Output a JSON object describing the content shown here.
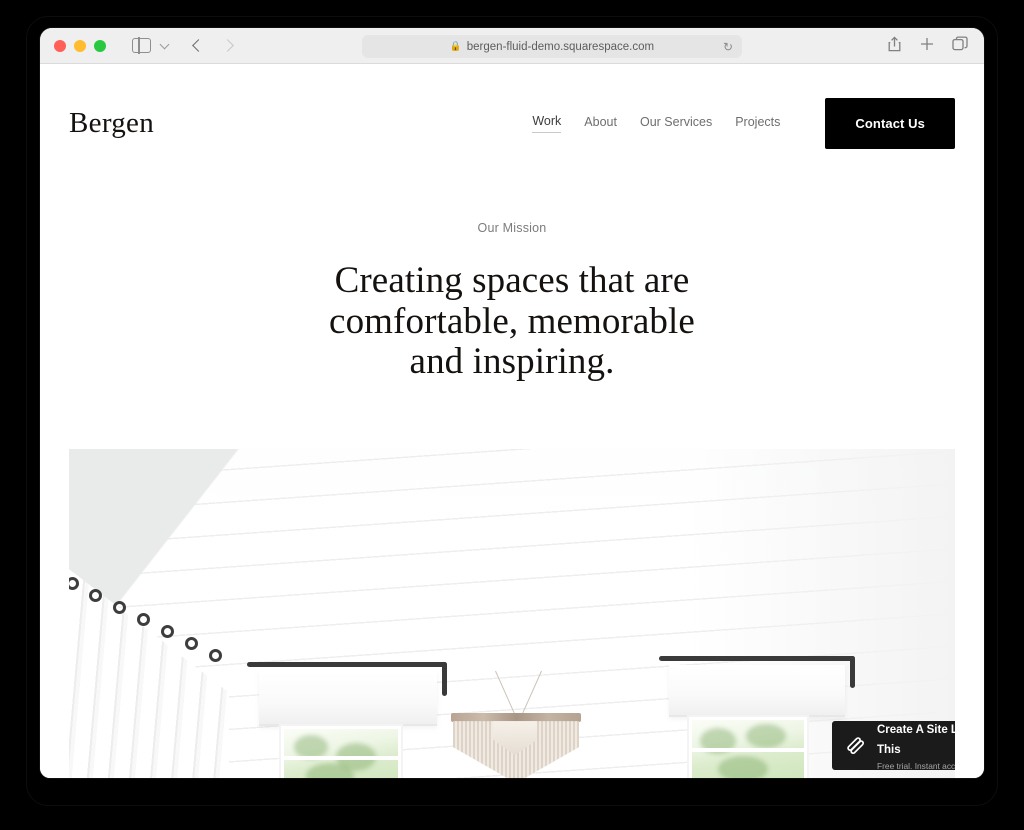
{
  "browser": {
    "traffic_lights": [
      "close",
      "minimize",
      "maximize"
    ],
    "sidebar_toggle": "sidebar-toggle",
    "sidebar_chevron": "chevron-down",
    "back": "back-arrow",
    "forward": "forward-arrow",
    "url": "bergen-fluid-demo.squarespace.com",
    "lock": "🔒",
    "reload": "↻",
    "share": "share-icon",
    "new_tab": "+",
    "tab_overview": "tab-overview-icon"
  },
  "site": {
    "logo": "Bergen",
    "nav": [
      {
        "label": "Work",
        "active": true
      },
      {
        "label": "About",
        "active": false
      },
      {
        "label": "Our Services",
        "active": false
      },
      {
        "label": "Projects",
        "active": false
      }
    ],
    "cta": "Contact Us"
  },
  "mission": {
    "eyebrow": "Our Mission",
    "headline": "Creating spaces that are comfortable, memorable and inspiring."
  },
  "hero": {
    "alt": "Bright white interior with shiplap ceiling, white curtains on black rings, macrame wall hanging and windows"
  },
  "badge": {
    "title": "Create A Site Like This",
    "subtitle": "Free trial. Instant access."
  },
  "colors": {
    "page_background": "#ffffff",
    "desktop_background": "#000000",
    "toolbar": "#f0efef",
    "cta_background": "#000000",
    "cta_text": "#ffffff",
    "badge_background": "#1b1b1b",
    "nav_text": "#6e6e6e",
    "heading_text": "#14110f"
  }
}
